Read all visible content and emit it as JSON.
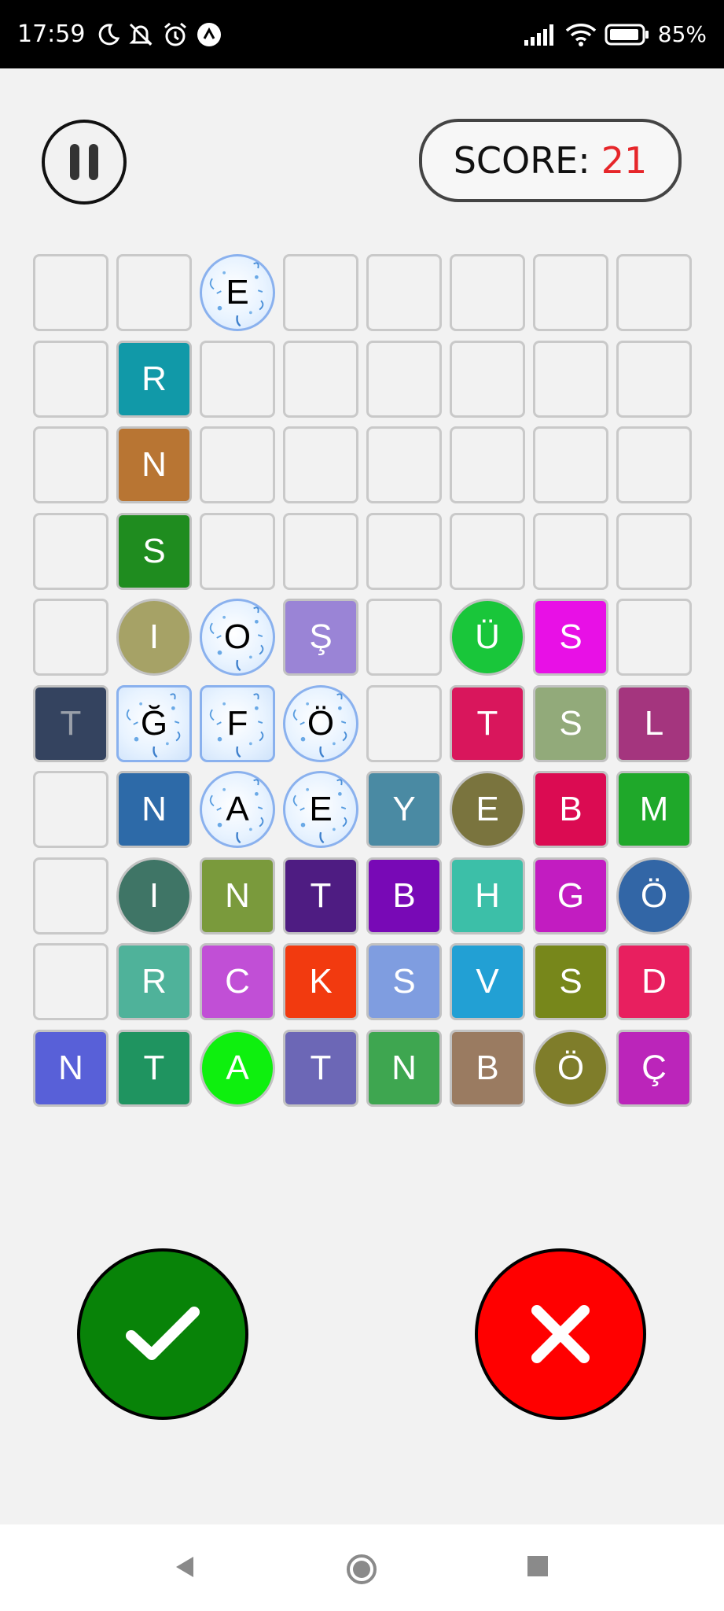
{
  "status_bar": {
    "time": "17:59",
    "battery_percent": "85%",
    "icons_left": [
      "moon-icon",
      "bell-off-icon",
      "alarm-icon",
      "app-a-icon"
    ],
    "icons_right": [
      "signal-icon",
      "wifi-icon",
      "battery-icon"
    ]
  },
  "header": {
    "score_label": "SCORE:",
    "score_value": "21",
    "score_value_color": "#e6262a"
  },
  "board": {
    "columns": 8,
    "rows": 10,
    "grid": [
      [
        null,
        null,
        {
          "letter": "E",
          "selected": true,
          "shape": "circle"
        },
        null,
        null,
        null,
        null,
        null
      ],
      [
        null,
        {
          "letter": "R",
          "color": "#1199a8"
        },
        null,
        null,
        null,
        null,
        null,
        null
      ],
      [
        null,
        {
          "letter": "N",
          "color": "#b87533"
        },
        null,
        null,
        null,
        null,
        null,
        null
      ],
      [
        null,
        {
          "letter": "S",
          "color": "#1f8c1f"
        },
        null,
        null,
        null,
        null,
        null,
        null
      ],
      [
        null,
        {
          "letter": "I",
          "color": "#a6a266",
          "shape": "circle"
        },
        {
          "letter": "O",
          "selected": true,
          "shape": "circle"
        },
        {
          "letter": "Ş",
          "color": "#9a84d6"
        },
        null,
        {
          "letter": "Ü",
          "color": "#19c63a",
          "shape": "circle"
        },
        {
          "letter": "S",
          "color": "#e810e6"
        },
        null
      ],
      [
        {
          "letter": "T",
          "color": "#34435f",
          "dim": true
        },
        {
          "letter": "Ğ",
          "selected": true,
          "shape": "square"
        },
        {
          "letter": "F",
          "selected": true,
          "shape": "square"
        },
        {
          "letter": "Ö",
          "selected": true,
          "shape": "circle"
        },
        null,
        {
          "letter": "T",
          "color": "#d9165c"
        },
        {
          "letter": "S",
          "color": "#92aa7a"
        },
        {
          "letter": "L",
          "color": "#a4357e"
        }
      ],
      [
        null,
        {
          "letter": "N",
          "color": "#2d6aa8"
        },
        {
          "letter": "A",
          "selected": true,
          "shape": "circle"
        },
        {
          "letter": "E",
          "selected": true,
          "shape": "circle"
        },
        {
          "letter": "Y",
          "color": "#4a8aa3"
        },
        {
          "letter": "E",
          "color": "#7a743e",
          "shape": "circle"
        },
        {
          "letter": "B",
          "color": "#db0b52"
        },
        {
          "letter": "M",
          "color": "#1fa82a"
        }
      ],
      [
        null,
        {
          "letter": "I",
          "color": "#3f7566",
          "shape": "circle"
        },
        {
          "letter": "N",
          "color": "#7a9a3c"
        },
        {
          "letter": "T",
          "color": "#4e1c82"
        },
        {
          "letter": "B",
          "color": "#7809b6"
        },
        {
          "letter": "H",
          "color": "#3cbfa8"
        },
        {
          "letter": "G",
          "color": "#c21cc1"
        },
        {
          "letter": "Ö",
          "color": "#3266a6",
          "shape": "circle"
        }
      ],
      [
        null,
        {
          "letter": "R",
          "color": "#4fb29a"
        },
        {
          "letter": "C",
          "color": "#c14fd6"
        },
        {
          "letter": "K",
          "color": "#f23a0f"
        },
        {
          "letter": "S",
          "color": "#7f9de0"
        },
        {
          "letter": "V",
          "color": "#22a0d4"
        },
        {
          "letter": "S",
          "color": "#77871b"
        },
        {
          "letter": "D",
          "color": "#e81f5f"
        }
      ],
      [
        {
          "letter": "N",
          "color": "#5860d8"
        },
        {
          "letter": "T",
          "color": "#1f9460"
        },
        {
          "letter": "A",
          "color": "#0ef00e",
          "shape": "circle"
        },
        {
          "letter": "T",
          "color": "#6c67b6"
        },
        {
          "letter": "N",
          "color": "#3ea650"
        },
        {
          "letter": "B",
          "color": "#9a7b61"
        },
        {
          "letter": "Ö",
          "color": "#7f7d2a",
          "shape": "circle"
        },
        {
          "letter": "Ç",
          "color": "#bb25ba"
        }
      ]
    ]
  },
  "actions": {
    "confirm_icon": "checkmark-icon",
    "confirm_color": "#088308",
    "cancel_icon": "x-icon",
    "cancel_color": "#ff0000"
  },
  "nav_bar": {
    "items": [
      "back-icon",
      "home-icon",
      "recents-icon"
    ]
  }
}
